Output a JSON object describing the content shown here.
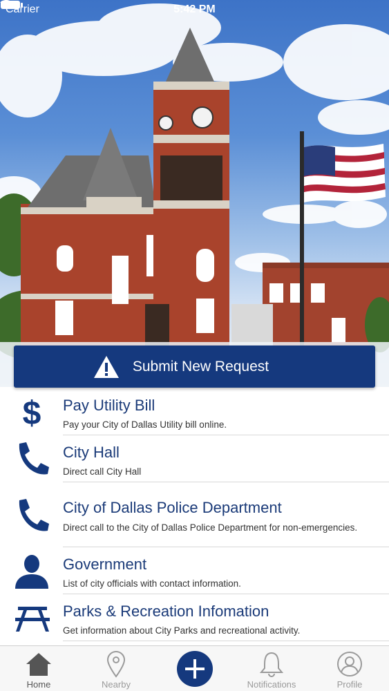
{
  "status_bar": {
    "carrier": "Carrier",
    "time": "5:42 PM"
  },
  "submit": {
    "label": "Submit New Request",
    "icon": "warning-triangle-icon"
  },
  "menu": [
    {
      "title": "Pay Utility Bill",
      "subtitle": "Pay your City of Dallas Utility bill online.",
      "icon": "dollar-icon"
    },
    {
      "title": "City Hall",
      "subtitle": "Direct call City Hall",
      "icon": "phone-icon"
    },
    {
      "title": "City of Dallas Police Department",
      "subtitle": "Direct call to the City of Dallas Police Department for non-emergencies.",
      "icon": "phone-icon"
    },
    {
      "title": "Government",
      "subtitle": "List of city officials with contact information.",
      "icon": "person-icon"
    },
    {
      "title": "Parks & Recreation Infomation",
      "subtitle": "Get information about City Parks and recreational activity.",
      "icon": "picnic-table-icon"
    }
  ],
  "tabs": [
    {
      "label": "Home",
      "icon": "home-icon",
      "active": true
    },
    {
      "label": "Nearby",
      "icon": "map-pin-icon",
      "active": false
    },
    {
      "label": "",
      "icon": "plus-icon",
      "active": false
    },
    {
      "label": "Notifications",
      "icon": "bell-icon",
      "active": false
    },
    {
      "label": "Profile",
      "icon": "profile-icon",
      "active": false
    }
  ],
  "colors": {
    "primary": "#15397e",
    "title_text": "#1a3a78",
    "tab_inactive": "#9a9a9a"
  }
}
